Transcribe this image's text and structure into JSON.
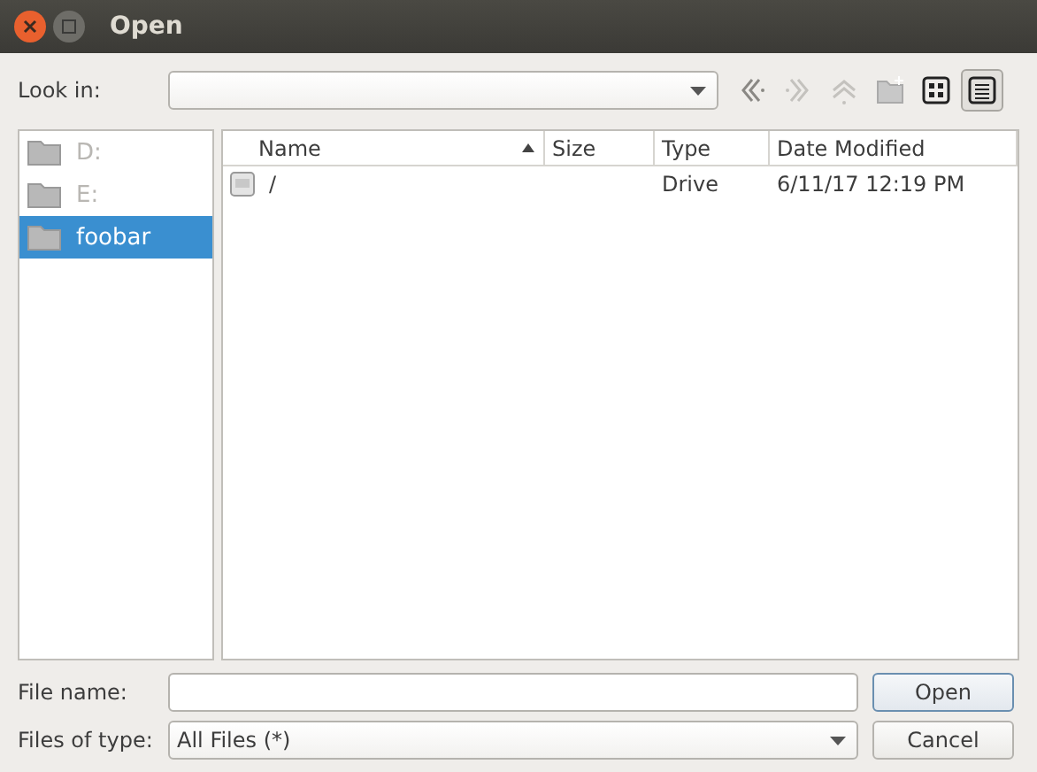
{
  "window": {
    "title": "Open"
  },
  "look_in": {
    "label": "Look in:"
  },
  "toolbar": [
    {
      "kind": "back",
      "disabled": false,
      "selected": false
    },
    {
      "kind": "forward",
      "disabled": true,
      "selected": false
    },
    {
      "kind": "up",
      "disabled": true,
      "selected": false
    },
    {
      "kind": "new-folder",
      "disabled": true,
      "selected": false
    },
    {
      "kind": "icon-view",
      "disabled": false,
      "selected": false
    },
    {
      "kind": "detail-view",
      "disabled": false,
      "selected": true
    }
  ],
  "sidebar": {
    "items": [
      {
        "label": "D:",
        "disabled": true,
        "selected": false
      },
      {
        "label": "E:",
        "disabled": true,
        "selected": false
      },
      {
        "label": "foobar",
        "disabled": false,
        "selected": true
      }
    ]
  },
  "table": {
    "columns": [
      {
        "label": "Name",
        "sorted": true
      },
      {
        "label": "Size",
        "sorted": false
      },
      {
        "label": "Type",
        "sorted": false
      },
      {
        "label": "Date Modified",
        "sorted": false
      }
    ],
    "rows": [
      {
        "name": "/",
        "type": "Drive",
        "date": "6/11/17 12:19 PM"
      }
    ]
  },
  "file_name": {
    "label": "File name:"
  },
  "file_type": {
    "label": "Files of type:",
    "value": "All Files (*)"
  },
  "buttons": [
    {
      "label": "Open",
      "default": true
    },
    {
      "label": "Cancel",
      "default": false
    }
  ]
}
